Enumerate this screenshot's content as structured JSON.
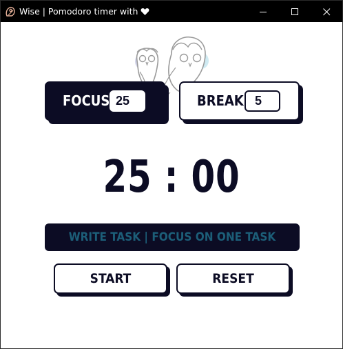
{
  "window": {
    "title": "Wise | Pomodoro timer with",
    "title_suffix_icon": "heart-icon",
    "app_icon": "owl-icon",
    "controls": [
      "minimize-icon",
      "maximize-icon",
      "close-icon"
    ]
  },
  "header": {
    "illustration": "two-owls-illustration"
  },
  "focus": {
    "label": "FOCUS",
    "value": "25"
  },
  "break": {
    "label": "BREAK",
    "value": "5"
  },
  "timer": {
    "display": "25 : 00"
  },
  "task": {
    "text": "WRITE TASK | FOCUS ON ONE TASK"
  },
  "actions": {
    "start_label": "START",
    "reset_label": "RESET"
  },
  "colors": {
    "dark": "#0c0c24",
    "accent_text": "#1c5e78",
    "titlebar": "#000000",
    "background": "#ffffff"
  }
}
